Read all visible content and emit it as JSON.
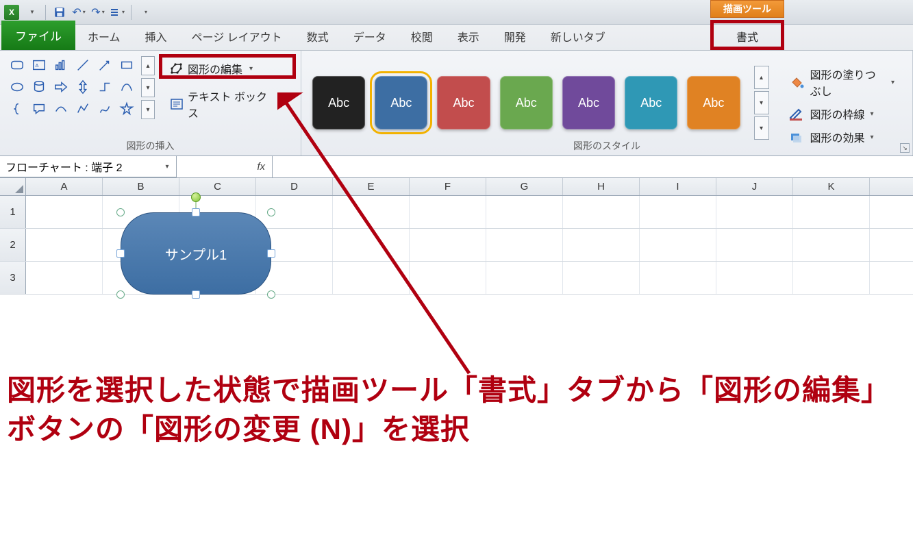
{
  "qat": {
    "excel_letter": "X"
  },
  "contextual_tab": "描画ツール",
  "tabs": {
    "file": "ファイル",
    "home": "ホーム",
    "insert": "挿入",
    "page_layout": "ページ レイアウト",
    "formulas": "数式",
    "data": "データ",
    "review": "校閲",
    "view": "表示",
    "developer": "開発",
    "new_tab": "新しいタブ",
    "format": "書式"
  },
  "ribbon": {
    "insert_shapes_group": "図形の挿入",
    "edit_shape": "図形の編集",
    "text_box": "テキスト ボックス",
    "shape_styles_group": "図形のスタイル",
    "style_label": "Abc",
    "style_colors": [
      "#222222",
      "#3d6ea3",
      "#c24d4d",
      "#6aa84f",
      "#704a9b",
      "#2f98b5",
      "#e08223"
    ],
    "shape_fill": "図形の塗りつぶし",
    "shape_outline": "図形の枠線",
    "shape_effects": "図形の効果"
  },
  "name_box": "フローチャート : 端子 2",
  "fx_label": "fx",
  "columns": [
    "A",
    "B",
    "C",
    "D",
    "E",
    "F",
    "G",
    "H",
    "I",
    "J",
    "K"
  ],
  "rows": [
    "1",
    "2",
    "3"
  ],
  "sheet_shape_text": "サンプル1",
  "annotation": "図形を選択した状態で描画ツール「書式」タブから「図形の編集」ボタンの「図形の変更 (N)」を選択"
}
